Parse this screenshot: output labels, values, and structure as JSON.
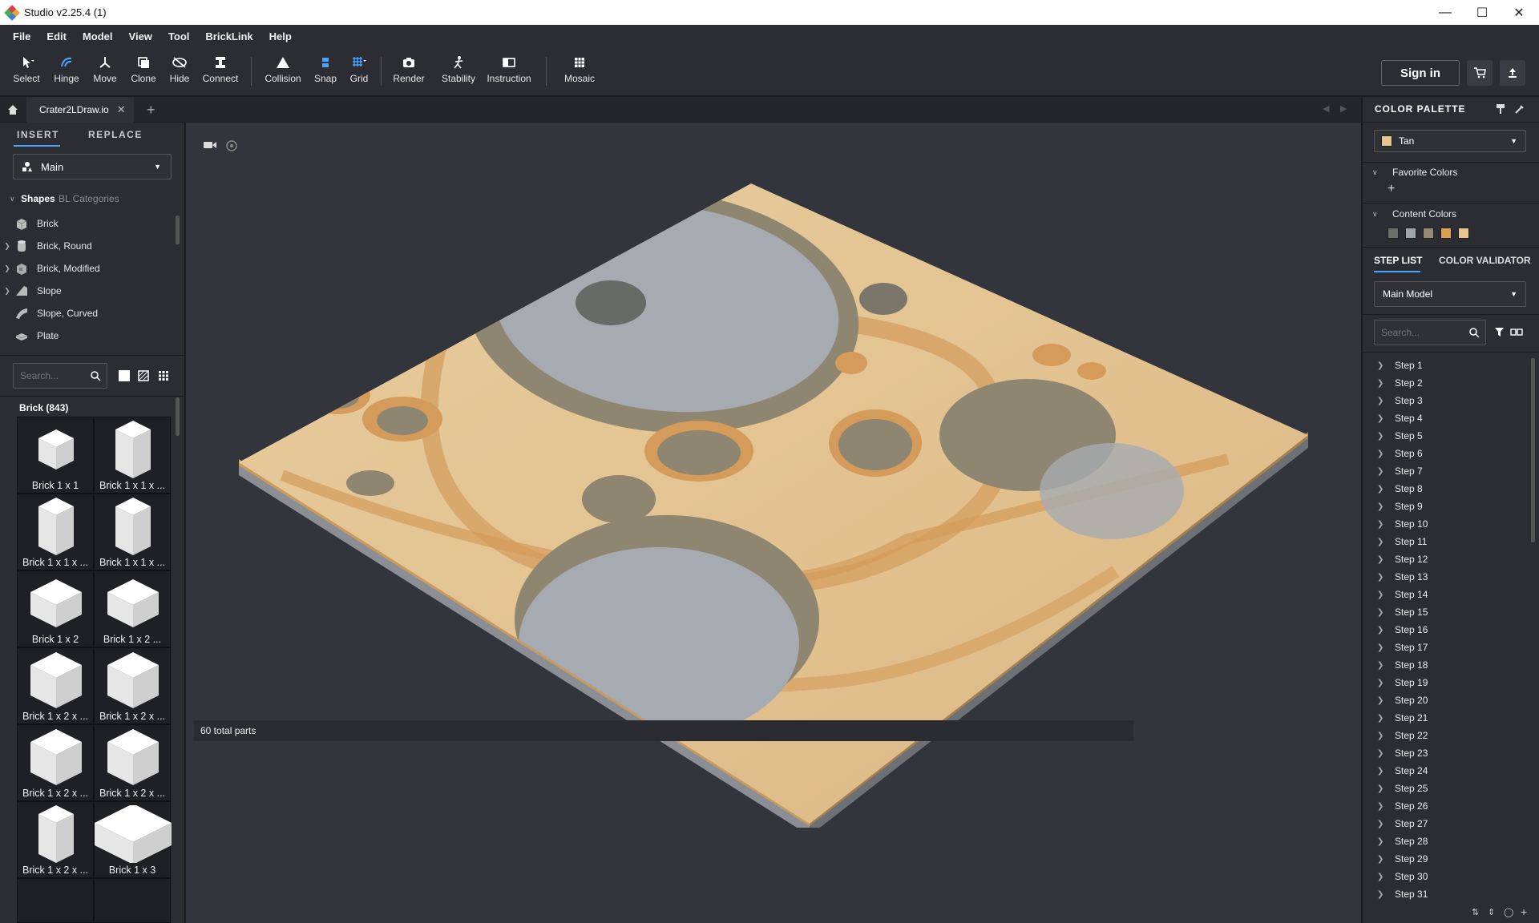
{
  "window": {
    "title": "Studio v2.25.4 (1)"
  },
  "menu": [
    "File",
    "Edit",
    "Model",
    "View",
    "Tool",
    "BrickLink",
    "Help"
  ],
  "toolbar": {
    "tools": [
      {
        "label": "Select",
        "icon": "cursor-icon"
      },
      {
        "label": "Hinge",
        "icon": "hinge-icon"
      },
      {
        "label": "Move",
        "icon": "move-icon"
      },
      {
        "label": "Clone",
        "icon": "clone-icon"
      },
      {
        "label": "Hide",
        "icon": "hide-icon"
      },
      {
        "label": "Connect",
        "icon": "connect-icon"
      },
      {
        "label": "Collision",
        "icon": "collision-icon"
      },
      {
        "label": "Snap",
        "icon": "snap-icon"
      },
      {
        "label": "Grid",
        "icon": "grid-icon"
      },
      {
        "label": "Render",
        "icon": "camera-icon"
      },
      {
        "label": "Stability",
        "icon": "stability-icon"
      },
      {
        "label": "Instruction",
        "icon": "instruction-icon"
      },
      {
        "label": "Mosaic",
        "icon": "mosaic-icon"
      }
    ],
    "sign_in": "Sign in"
  },
  "tabs": {
    "document": "Crater2LDraw.io"
  },
  "left": {
    "tab_insert": "INSERT",
    "tab_replace": "REPLACE",
    "palette_select": "Main",
    "shapes_tab": "Shapes",
    "bl_tab": "BL Categories",
    "shapes": [
      "Brick",
      "Brick, Round",
      "Brick, Modified",
      "Slope",
      "Slope, Curved",
      "Plate"
    ],
    "search_placeholder": "Search...",
    "category_title": "Brick (843)",
    "parts": [
      "Brick 1 x 1",
      "Brick 1 x 1 x ...",
      "Brick 1 x 1 x ...",
      "Brick 1 x 1 x ...",
      "Brick 1 x 2",
      "Brick 1 x 2 ...",
      "Brick 1 x 2 x ...",
      "Brick 1 x 2 x ...",
      "Brick 1 x 2 x ...",
      "Brick 1 x 2 x ...",
      "Brick 1 x 2 x ...",
      "Brick 1 x 3"
    ]
  },
  "viewport": {
    "status": "60 total parts"
  },
  "right": {
    "palette_title": "COLOR PALETTE",
    "selected_color": "Tan",
    "selected_color_hex": "#e4c593",
    "favorite_colors": "Favorite Colors",
    "content_colors": "Content Colors",
    "content_swatches": [
      "#6c6e68",
      "#a0a5a9",
      "#958a73",
      "#dd9e55",
      "#e4c593"
    ],
    "tab_steps": "STEP LIST",
    "tab_validator": "COLOR VALIDATOR",
    "model_select": "Main Model",
    "search_placeholder": "Search...",
    "steps": [
      "Step 1",
      "Step 2",
      "Step 3",
      "Step 4",
      "Step 5",
      "Step 6",
      "Step 7",
      "Step 8",
      "Step 9",
      "Step 10",
      "Step 11",
      "Step 12",
      "Step 13",
      "Step 14",
      "Step 15",
      "Step 16",
      "Step 17",
      "Step 18",
      "Step 19",
      "Step 20",
      "Step 21",
      "Step 22",
      "Step 23",
      "Step 24",
      "Step 25",
      "Step 26",
      "Step 27",
      "Step 28",
      "Step 29",
      "Step 30",
      "Step 31"
    ]
  }
}
